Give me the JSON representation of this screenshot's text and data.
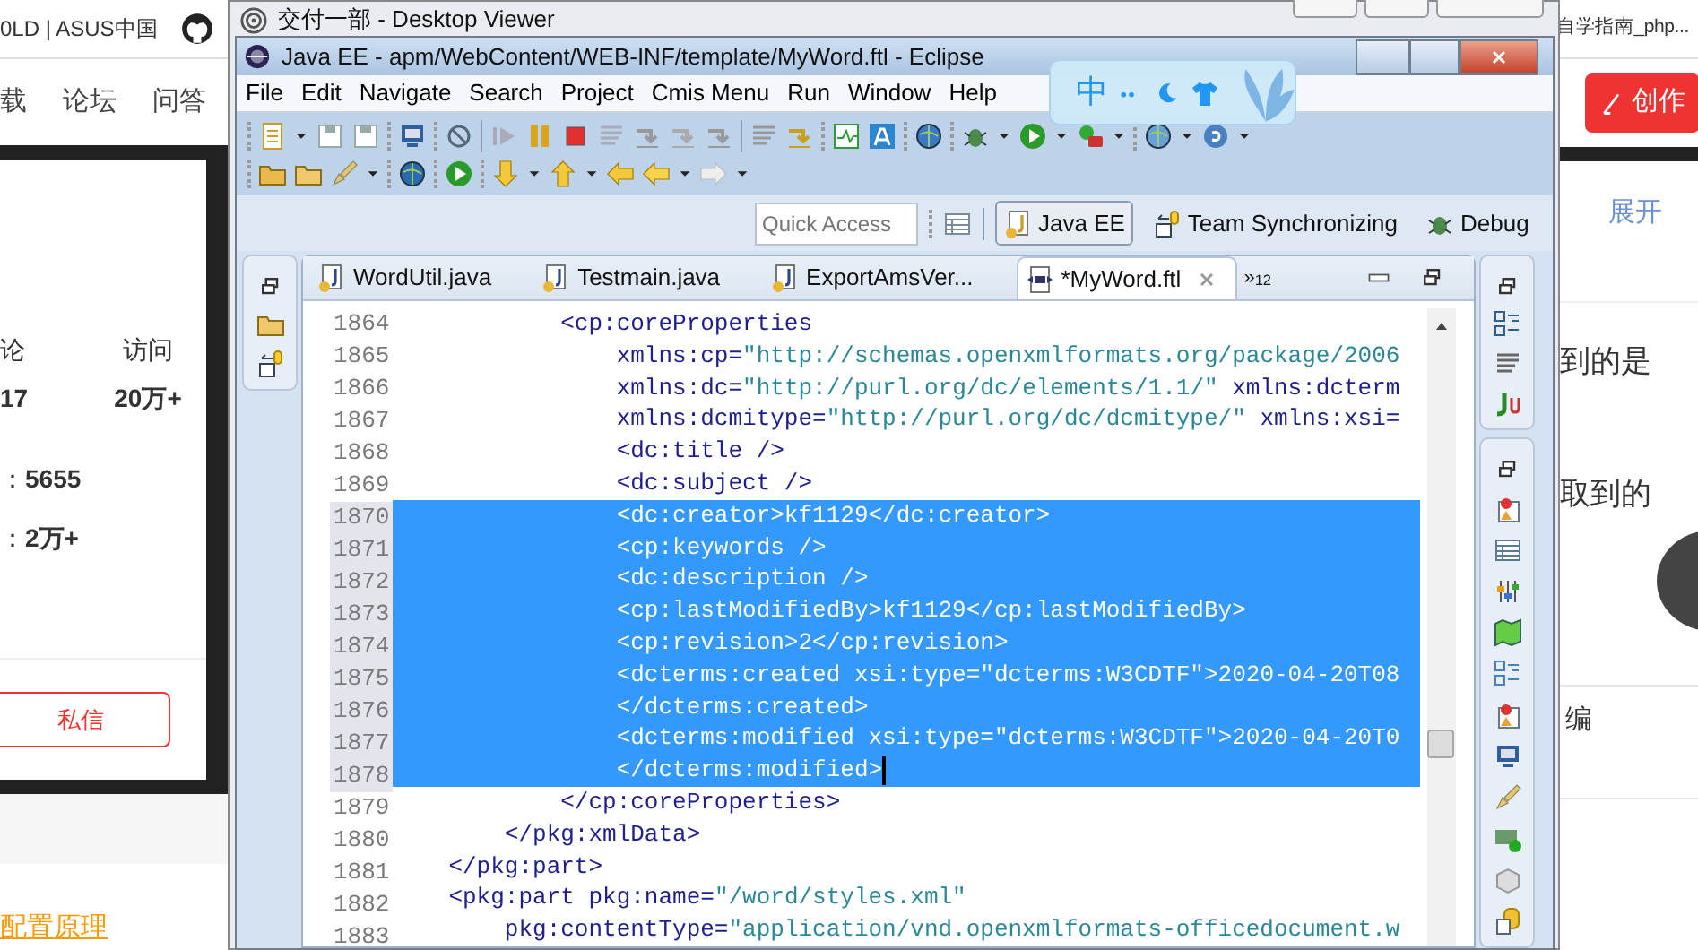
{
  "background_page": {
    "header_text": "0LD | ASUS中国",
    "nav": [
      "载",
      "论坛",
      "问答"
    ],
    "stats": [
      {
        "label": "论",
        "value": "17"
      },
      {
        "label": "访问",
        "value": "20万+"
      }
    ],
    "ranks": [
      {
        "label": "：",
        "value": "5655"
      },
      {
        "label": "：",
        "value": "2万+"
      }
    ],
    "message_button": "私信",
    "link": "配置原理",
    "right_title": "自学指南_php...",
    "create_button": "创作",
    "expand_link": "展开",
    "snippets": [
      "到的是",
      "取到的",
      "编"
    ]
  },
  "viewer": {
    "title": "交付一部 - Desktop Viewer"
  },
  "eclipse": {
    "title": "Java EE - apm/WebContent/WEB-INF/template/MyWord.ftl - Eclipse",
    "menu": [
      "File",
      "Edit",
      "Navigate",
      "Search",
      "Project",
      "Cmis Menu",
      "Run",
      "Window",
      "Help"
    ],
    "ime": {
      "label": "中"
    },
    "quick_access": {
      "placeholder": "Quick Access"
    },
    "perspectives": [
      {
        "label": "Java EE",
        "selected": true
      },
      {
        "label": "Team Synchronizing",
        "selected": false
      },
      {
        "label": "Debug",
        "selected": false
      }
    ],
    "tabs": [
      {
        "label": "WordUtil.java",
        "kind": "java",
        "selected": false
      },
      {
        "label": "Testmain.java",
        "kind": "java",
        "selected": false
      },
      {
        "label": "ExportAmsVer...",
        "kind": "java",
        "selected": false
      },
      {
        "label": "*MyWord.ftl",
        "kind": "ftl",
        "selected": true
      }
    ],
    "overflow": {
      "symbol": "»",
      "count": "12"
    },
    "lines": [
      {
        "number": "1864",
        "text": "            <cp:coreProperties",
        "selected": false
      },
      {
        "number": "1865",
        "text": "                xmlns:cp=\"http://schemas.openxmlformats.org/package/2006",
        "selected": false
      },
      {
        "number": "1866",
        "text": "                xmlns:dc=\"http://purl.org/dc/elements/1.1/\" xmlns:dcterm",
        "selected": false
      },
      {
        "number": "1867",
        "text": "                xmlns:dcmitype=\"http://purl.org/dc/dcmitype/\" xmlns:xsi=",
        "selected": false
      },
      {
        "number": "1868",
        "text": "                <dc:title />",
        "selected": false
      },
      {
        "number": "1869",
        "text": "                <dc:subject />",
        "selected": false
      },
      {
        "number": "1870",
        "text": "                <dc:creator>kf1129</dc:creator>",
        "selected": true
      },
      {
        "number": "1871",
        "text": "                <cp:keywords />",
        "selected": true
      },
      {
        "number": "1872",
        "text": "                <dc:description />",
        "selected": true
      },
      {
        "number": "1873",
        "text": "                <cp:lastModifiedBy>kf1129</cp:lastModifiedBy>",
        "selected": true
      },
      {
        "number": "1874",
        "text": "                <cp:revision>2</cp:revision>",
        "selected": true
      },
      {
        "number": "1875",
        "text": "                <dcterms:created xsi:type=\"dcterms:W3CDTF\">2020-04-20T08",
        "selected": true
      },
      {
        "number": "1876",
        "text": "                </dcterms:created>",
        "selected": true
      },
      {
        "number": "1877",
        "text": "                <dcterms:modified xsi:type=\"dcterms:W3CDTF\">2020-04-20T0",
        "selected": true
      },
      {
        "number": "1878",
        "text": "                </dcterms:modified>",
        "selected": true,
        "cursor": true
      },
      {
        "number": "1879",
        "text": "            </cp:coreProperties>",
        "selected": false
      },
      {
        "number": "1880",
        "text": "        </pkg:xmlData>",
        "selected": false
      },
      {
        "number": "1881",
        "text": "    </pkg:part>",
        "selected": false
      },
      {
        "number": "1882",
        "text": "    <pkg:part pkg:name=\"/word/styles.xml\"",
        "selected": false
      },
      {
        "number": "1883",
        "text": "        pkg:contentType=\"application/vnd.openxmlformats-officedocument.w",
        "selected": false
      }
    ]
  }
}
